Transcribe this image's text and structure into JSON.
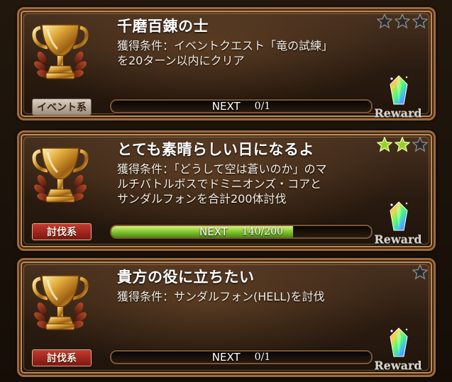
{
  "trophies": [
    {
      "title": "千磨百錬の士",
      "description": "獲得条件：イベントクエスト「竜の試練」を20ターン以内にクリア",
      "category": "イベント系",
      "category_style": "event",
      "progress_label": "NEXT",
      "progress_count": "0/1",
      "progress_fraction": 0,
      "stars_filled": 0,
      "stars_total": 3,
      "reward_label": "Reward"
    },
    {
      "title": "とても素晴らしい日になるよ",
      "description": "獲得条件：「どうして空は蒼いのか」のマルチバトルボスでドミニオンズ・コアとサンダルフォンを合計200体討伐",
      "category": "討伐系",
      "category_style": "subjugate",
      "progress_label": "NEXT",
      "progress_count": "140/200",
      "progress_fraction": 0.7,
      "stars_filled": 2,
      "stars_total": 3,
      "reward_label": "Reward"
    },
    {
      "title": "貴方の役に立ちたい",
      "description": "獲得条件：サンダルフォン(HELL)を討伐",
      "category": "討伐系",
      "category_style": "subjugate",
      "progress_label": "NEXT",
      "progress_count": "0/1",
      "progress_fraction": 0,
      "stars_filled": 0,
      "stars_total": 1,
      "reward_label": "Reward"
    }
  ],
  "icons": {
    "trophy": "trophy-icon",
    "star_filled": "star-filled-icon",
    "star_empty": "star-empty-icon",
    "reward_gem": "rainbow-crystal-icon"
  },
  "colors": {
    "frame": "#a06a3b",
    "progress_fill": "#7cc22a",
    "star_filled": "#9acd32",
    "star_empty": "#3a3a3a",
    "category_subjugate": "#c23a2e",
    "category_event": "#cfc4b8"
  }
}
